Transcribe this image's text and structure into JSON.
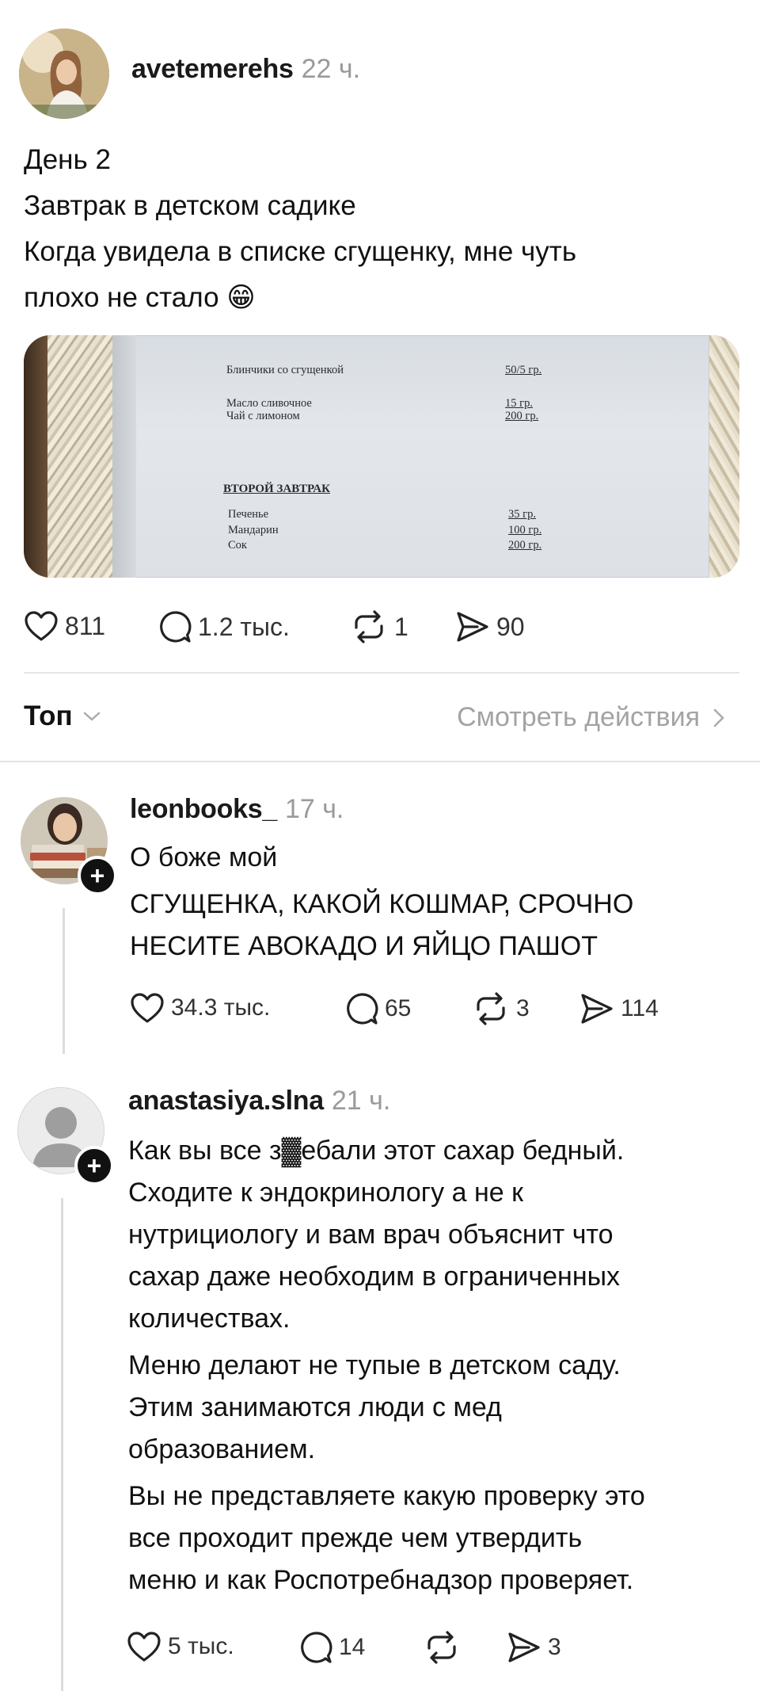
{
  "post": {
    "username": "avetemerehs",
    "time": "22 ч.",
    "lines": [
      "День 2",
      "Завтрак в детском садике",
      "Когда увидела в списке сгущенку, мне чуть",
      "плохо не стало 😁"
    ],
    "menu_image": {
      "rows": [
        {
          "item": "Блинчики со сгущенкой",
          "amount": "50/5 гр."
        },
        {
          "item": "Масло сливочное",
          "amount": "15 гр."
        },
        {
          "item": "Чай с лимоном",
          "amount": "200 гр."
        }
      ],
      "section_title": "ВТОРОЙ ЗАВТРАК",
      "section_rows": [
        {
          "item": "Печенье",
          "amount": "35 гр."
        },
        {
          "item": "Мандарин",
          "amount": "100 гр."
        },
        {
          "item": "Сок",
          "amount": "200 гр."
        }
      ]
    },
    "actions": {
      "likes": "811",
      "comments": "1.2 тыс.",
      "reposts": "1",
      "shares": "90"
    }
  },
  "sort": {
    "label": "Топ",
    "see_actions": "Смотреть действия"
  },
  "comments": [
    {
      "username": "leonbooks_",
      "time": "17 ч.",
      "paragraphs": [
        [
          "О боже мой"
        ],
        [
          "СГУЩЕНКА, КАКОЙ КОШМАР, СРОЧНО",
          "НЕСИТЕ АВОКАДО И ЯЙЦО ПАШОТ"
        ]
      ],
      "actions": {
        "likes": "34.3 тыс.",
        "comments": "65",
        "reposts": "3",
        "shares": "114"
      }
    },
    {
      "username": "anastasiya.slna",
      "time": "21 ч.",
      "paragraphs": [
        [
          "Как вы все з▓ебали этот сахар бедный.",
          "Сходите к эндокринологу а не к",
          "нутрициологу и вам врач объяснит что",
          "сахар даже необходим в ограниченных",
          "количествах."
        ],
        [
          "Меню делают не тупые в детском саду.",
          "Этим занимаются люди с мед",
          "образованием."
        ],
        [
          "Вы не представляете какую проверку это",
          "все проходит прежде чем утвердить",
          "меню и как Роспотребнадзор проверяет."
        ]
      ],
      "actions": {
        "likes": "5 тыс.",
        "comments": "14",
        "reposts": "",
        "shares": "3"
      }
    }
  ],
  "colors": {
    "text": "#111111",
    "muted": "#9a9a9a",
    "divider": "#e4e4e4"
  },
  "icons": [
    "heart-icon",
    "comment-icon",
    "repost-icon",
    "share-icon",
    "chevron-down-icon",
    "chevron-right-icon",
    "plus-icon",
    "default-avatar-icon"
  ]
}
